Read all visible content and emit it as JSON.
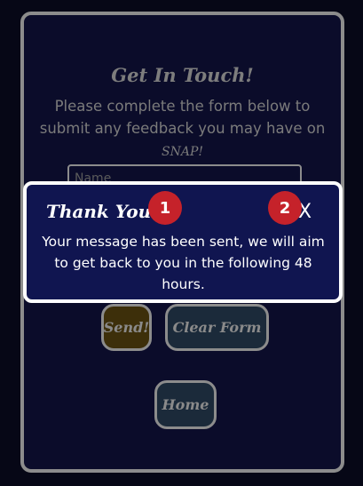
{
  "form": {
    "title": "Get In Touch!",
    "subtitle_text": "Please complete the form below to submit any feedback you may have on",
    "brand": "SNAP!",
    "name_placeholder": "Name",
    "send_label": "Send!",
    "clear_label": "Clear Form",
    "home_label": "Home"
  },
  "modal": {
    "title": "Thank You!",
    "close_label": "X",
    "message": "Your message has been sent, we will aim to get back to you in the following 48 hours."
  },
  "markers": {
    "one": "1",
    "two": "2"
  },
  "colors": {
    "page_background": "#060716",
    "modal_background": "#101550",
    "marker": "#c5222a",
    "send_button": "#3d2f0a",
    "secondary_button": "#1b2a3a"
  }
}
